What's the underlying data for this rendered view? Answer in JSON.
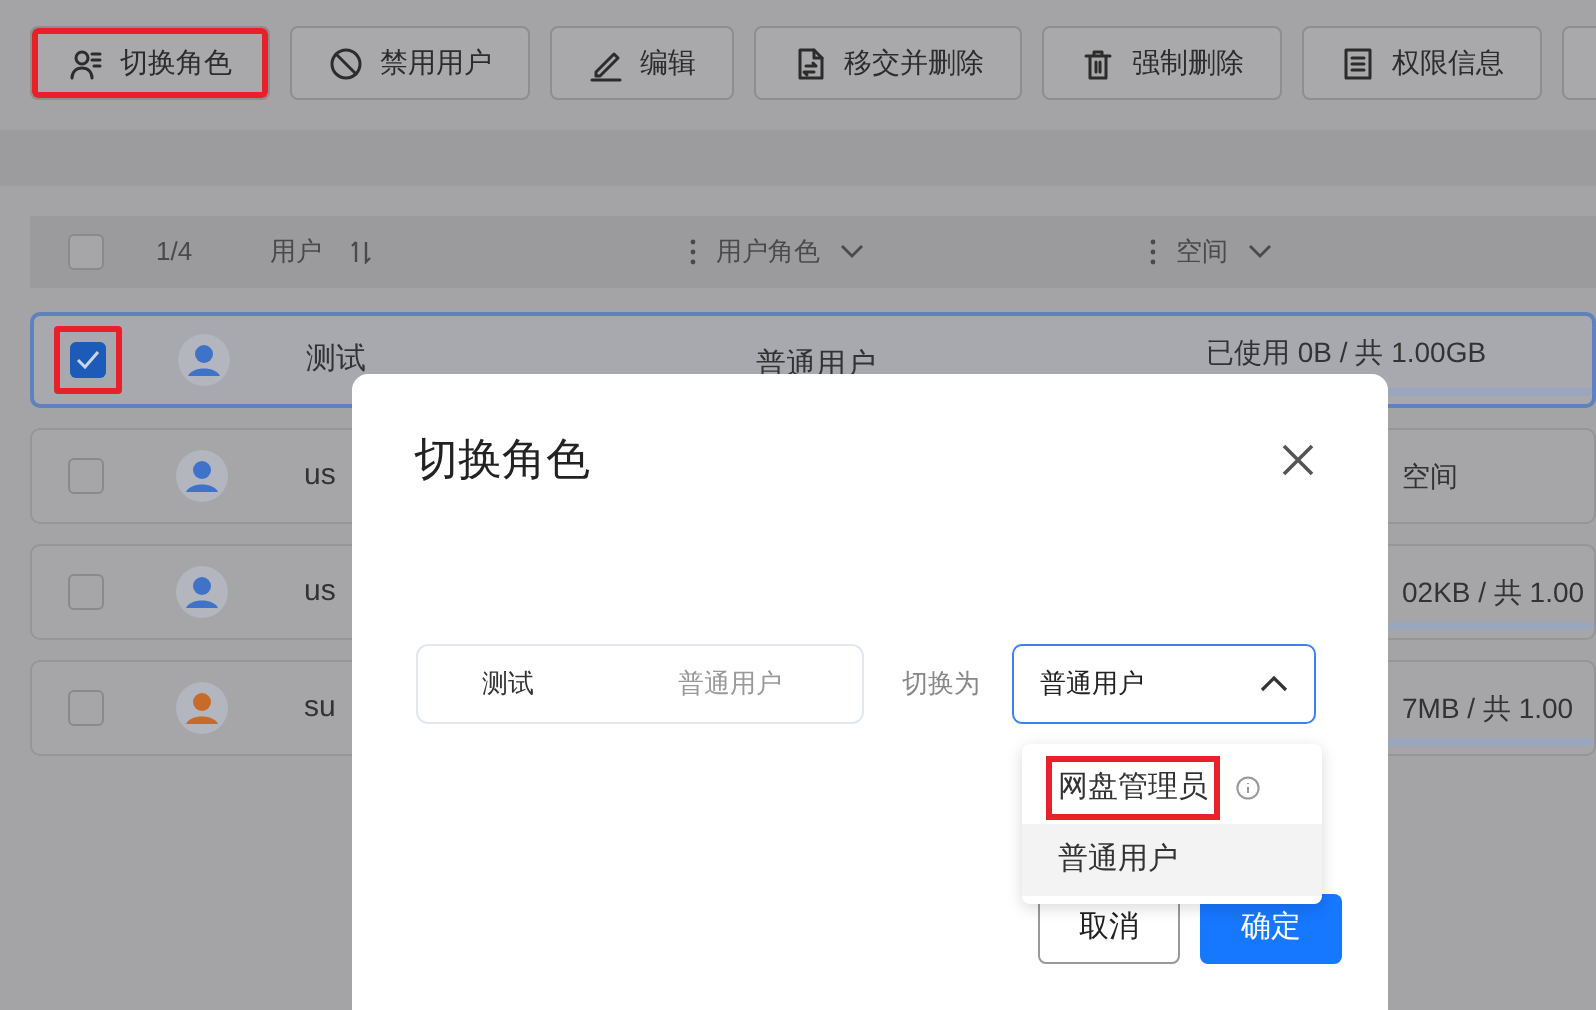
{
  "toolbar": [
    {
      "label": "切换角色",
      "highlighted": true
    },
    {
      "label": "禁用用户",
      "highlighted": false
    },
    {
      "label": "编辑",
      "highlighted": false
    },
    {
      "label": "移交并删除",
      "highlighted": false
    },
    {
      "label": "强制删除",
      "highlighted": false
    },
    {
      "label": "权限信息",
      "highlighted": false
    }
  ],
  "table": {
    "all_checked": false,
    "count": "1/4",
    "columns": [
      "用户",
      "用户角色",
      "空间"
    ],
    "rows": [
      {
        "selected": true,
        "checked": true,
        "highlighted": true,
        "color": "#3f73c9",
        "name": "测试",
        "role": "普通用户",
        "space": "已使用 0B / 共 1.00GB"
      },
      {
        "selected": false,
        "checked": false,
        "highlighted": false,
        "color": "#3f73c9",
        "name": "us",
        "space": "空间"
      },
      {
        "selected": false,
        "checked": false,
        "highlighted": false,
        "color": "#3f73c9",
        "name": "us",
        "space": "02KB / 共 1.00"
      },
      {
        "selected": false,
        "checked": false,
        "highlighted": false,
        "color": "#c86a2a",
        "name": "su",
        "space": "7MB / 共 1.00"
      }
    ]
  },
  "dialog": {
    "title": "切换角色",
    "user": "测试",
    "current_role": "普通用户",
    "switch_label": "切换为",
    "select_value": "普通用户",
    "options": [
      {
        "label": "网盘管理员",
        "info": true,
        "highlighted": true,
        "hovered": false
      },
      {
        "label": "普通用户",
        "info": false,
        "highlighted": false,
        "hovered": true
      }
    ],
    "buttons": [
      {
        "label": "取消",
        "kind": "secondary"
      },
      {
        "label": "确定",
        "kind": "primary"
      }
    ]
  }
}
